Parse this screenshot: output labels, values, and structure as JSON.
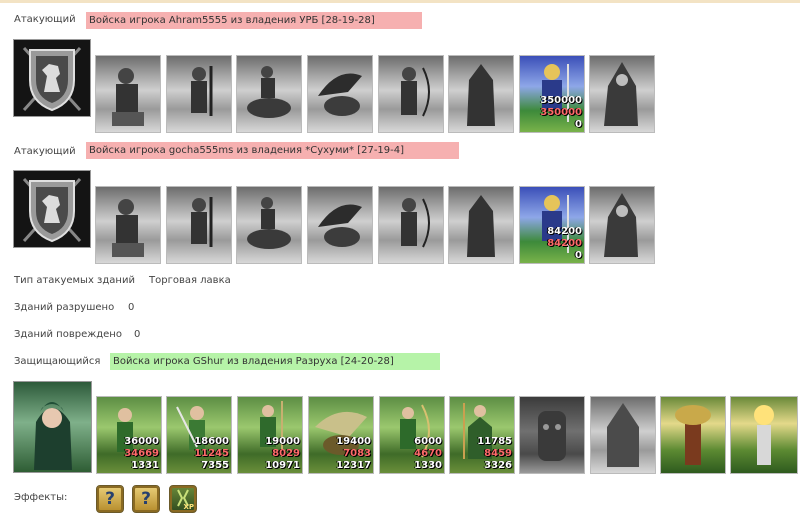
{
  "sections": [
    {
      "label": "Атакующий",
      "tag": "Войска игрока Ahram5555 из владения УРБ [28-19-28]",
      "units_nums": [
        {
          "n1": "350000",
          "n2": "350000",
          "n3": "0"
        }
      ]
    },
    {
      "label": "Атакующий",
      "tag": "Войска игрока gocha555ms из владения *Сухуми* [27-19-4]",
      "units_nums": [
        {
          "n1": "84200",
          "n2": "84200",
          "n3": "0"
        }
      ]
    }
  ],
  "info": {
    "target_label": "Тип атакуемых зданий",
    "target_value": "Торговая лавка",
    "destroyed_label": "Зданий разрушено",
    "destroyed_value": "0",
    "damaged_label": "Зданий повреждено",
    "damaged_value": "0"
  },
  "defender": {
    "label": "Защищающийся",
    "tag": "Войска игрока GShur из владения Разруха [24-20-28]",
    "units": [
      {
        "n1": "36000",
        "n2": "34669",
        "n3": "1331"
      },
      {
        "n1": "18600",
        "n2": "11245",
        "n3": "7355"
      },
      {
        "n1": "19000",
        "n2": "8029",
        "n3": "10971"
      },
      {
        "n1": "19400",
        "n2": "7083",
        "n3": "12317"
      },
      {
        "n1": "6000",
        "n2": "4670",
        "n3": "1330"
      },
      {
        "n1": "11785",
        "n2": "8459",
        "n3": "3326"
      }
    ]
  },
  "effects": {
    "label": "Эффекты:",
    "items": [
      "?",
      "?",
      "XP"
    ]
  },
  "colors": {
    "red_tag": "#f6b0b0",
    "green_tag": "#b6f3a8"
  }
}
